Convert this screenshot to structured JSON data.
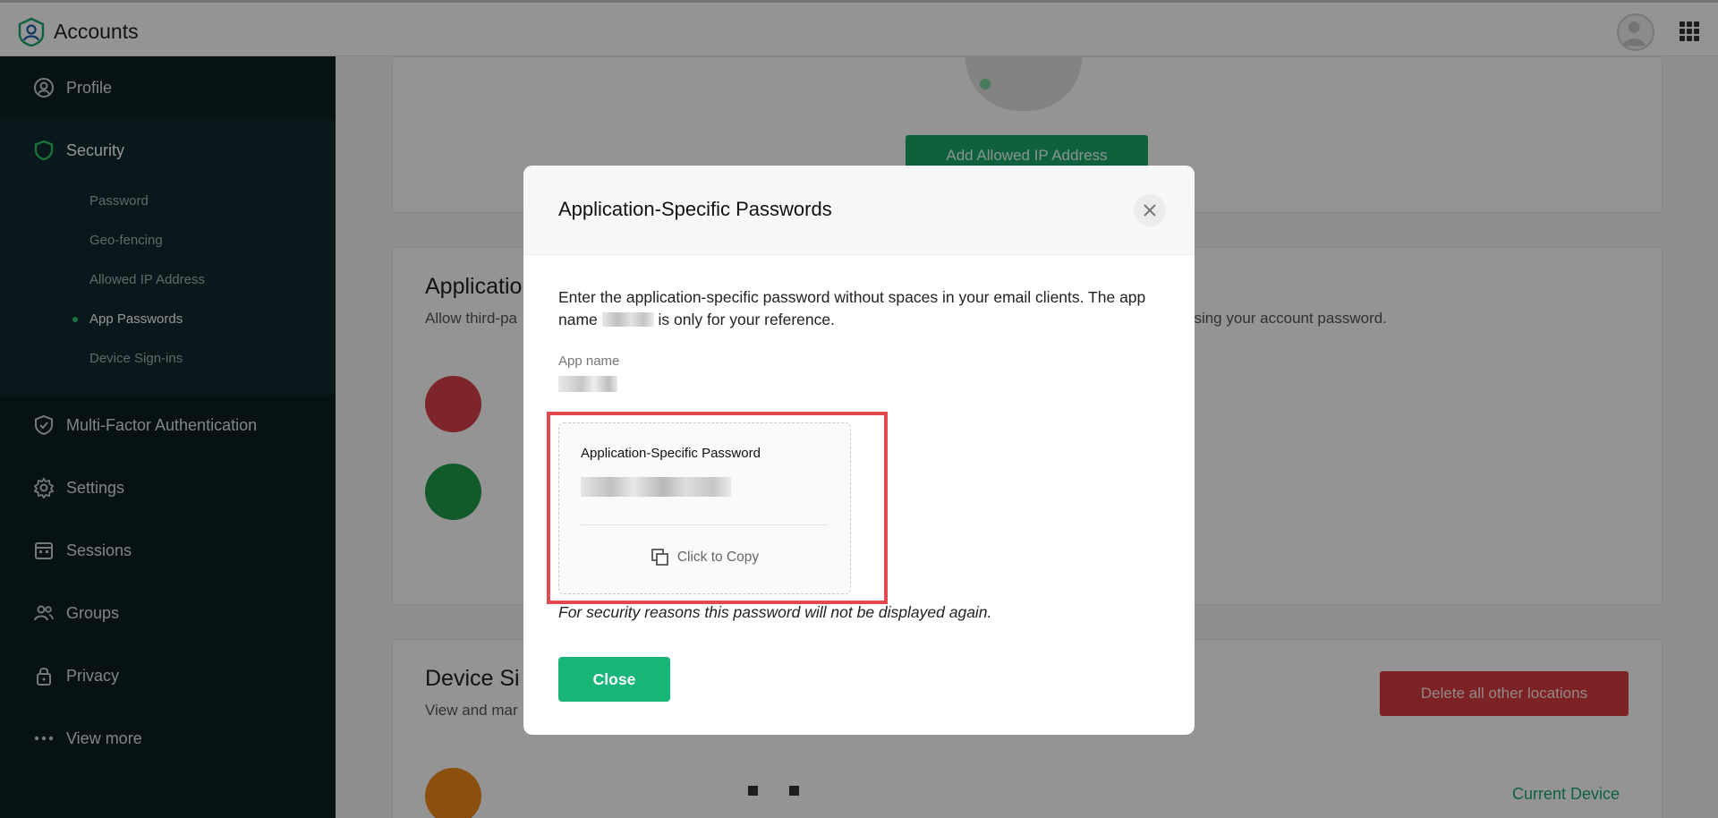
{
  "header": {
    "title": "Accounts",
    "logo_icon": "accounts-logo-icon",
    "avatar_icon": "user-avatar-icon",
    "apps_icon": "apps-grid-icon"
  },
  "sidebar": {
    "items": [
      {
        "label": "Profile",
        "icon": "profile-icon"
      },
      {
        "label": "Security",
        "icon": "shield-icon"
      },
      {
        "label": "Multi-Factor Authentication",
        "icon": "shield-check-icon"
      },
      {
        "label": "Settings",
        "icon": "gear-icon"
      },
      {
        "label": "Sessions",
        "icon": "calendar-icon"
      },
      {
        "label": "Groups",
        "icon": "users-icon"
      },
      {
        "label": "Privacy",
        "icon": "lock-icon"
      },
      {
        "label": "View more",
        "icon": "more-dots-icon"
      }
    ],
    "security_subitems": [
      "Password",
      "Geo-fencing",
      "Allowed IP Address",
      "App Passwords",
      "Device Sign-ins"
    ],
    "active_subitem": "App Passwords"
  },
  "background": {
    "add_ip_button": "Add Allowed IP Address",
    "app_passwords_heading": "Applicatio",
    "app_passwords_desc_left": "Allow third-pa",
    "app_passwords_desc_right": "using your account password.",
    "device_signins_heading": "Device Si",
    "device_signins_desc": "View and mar",
    "delete_button": "Delete all other locations",
    "current_device": "Current Device"
  },
  "modal": {
    "title": "Application-Specific Passwords",
    "intro_part1": "Enter the application-specific password without spaces in your email clients. The app name ",
    "intro_part2": " is only for your reference.",
    "app_name_label": "App name",
    "password_label": "Application-Specific Password",
    "copy_label": "Click to Copy",
    "warning": "For security reasons this password will not be displayed again.",
    "close_button": "Close"
  },
  "colors": {
    "sidebar_bg": "#0b1f22",
    "accent_green": "#17b578",
    "highlight_red": "#e14a4f",
    "danger_red": "#d6393f"
  }
}
